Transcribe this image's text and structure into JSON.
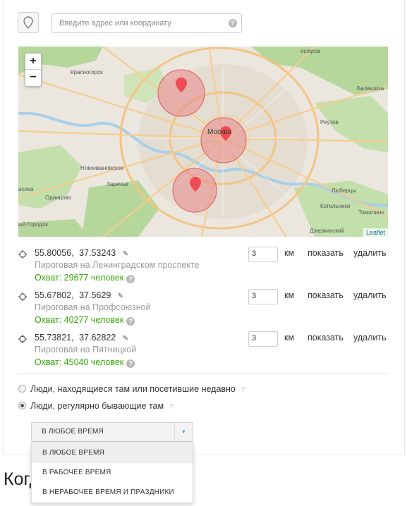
{
  "search": {
    "placeholder": "Введите адрес или координату",
    "help": "?"
  },
  "map": {
    "zoom_in": "+",
    "zoom_out": "−",
    "attribution": "Leaflet",
    "labels": {
      "ostrov": "остров",
      "krasnogorsk": "Красногорск",
      "balashikha": "Балашиха",
      "reutov": "Реутов",
      "moskva": "Москва",
      "novoivanovskoe": "Новоивановское",
      "zarechye": "Заречье",
      "odintsovo": "Одинцово",
      "lyubertsy": "Люберцы",
      "kotelniki": "Котельники",
      "tomilino": "Томилино",
      "dzerzhinsky": "Дзержинский",
      "gorodok": "ый Городок",
      "asikha": "асиха"
    },
    "colors": {
      "circle_fill": "#e8898c",
      "circle_stroke": "#e05a5f",
      "marker": "#ef4b55",
      "forest": "#b4d69a",
      "road_major": "#f7c98a"
    }
  },
  "locations": [
    {
      "lat": "55.80056,",
      "lon": "37.53243",
      "name": "Пироговая на Ленинградском проспекте",
      "reach": "Охват: 29677 человек",
      "radius": "3",
      "km": "км",
      "show": "показать",
      "delete": "удалить"
    },
    {
      "lat": "55.67802,",
      "lon": "37.5629",
      "name": "Пироговая на Профсоюзной",
      "reach": "Охват: 40277 человек",
      "radius": "3",
      "km": "км",
      "show": "показать",
      "delete": "удалить"
    },
    {
      "lat": "55.73821,",
      "lon": "37.62822",
      "name": "Пироговая на Пятницкой",
      "reach": "Охват: 45040 человек",
      "radius": "3",
      "km": "км",
      "show": "показать",
      "delete": "удалить"
    }
  ],
  "audience": {
    "option1": "Люди, находящиеся там или посетившие недавно",
    "option2": "Люди, регулярно бывающие там",
    "help": "?",
    "selected": "option2"
  },
  "time_select": {
    "value": "В ЛЮБОЕ ВРЕМЯ",
    "options": [
      "В ЛЮБОЕ ВРЕМЯ",
      "В РАБОЧЕЕ ВРЕМЯ",
      "В НЕРАБОЧЕЕ ВРЕМЯ И ПРАЗДНИКИ"
    ]
  },
  "heading": "Когд"
}
